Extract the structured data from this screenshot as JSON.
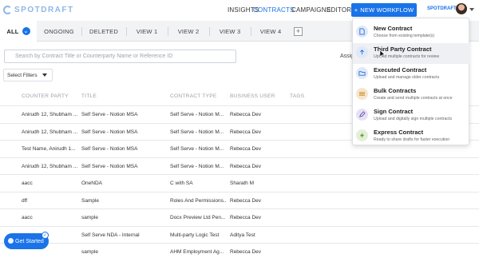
{
  "header": {
    "logo_text": "SPOTDRAFT",
    "nav": [
      "INSIGHTS",
      "CONTRACTS",
      "CAMPAIGNS",
      "EDITOR"
    ],
    "new_workflow": "NEW WORKFLOW",
    "brand_small": "SPOTDRAFT",
    "accent": "#1a73e8"
  },
  "tabs": {
    "items": [
      "ALL",
      "ONGOING",
      "DELETED",
      "VIEW 1",
      "VIEW 2",
      "VIEW 3",
      "VIEW 4"
    ],
    "add": "+"
  },
  "search": {
    "placeholder": "Search by Contract Title or Counterparty Name or Reference ID"
  },
  "assign_label": "Assig",
  "filters_label": "Select Filters",
  "table": {
    "columns": [
      "COUNTER PARTY",
      "TITLE",
      "CONTRACT TYPE",
      "BUSINESS USER",
      "TAGS"
    ],
    "rows": [
      [
        "Anirudh 12, Shubham ...",
        "Self Serve - Notion MSA",
        "Self Serve - Notion M...",
        "Rebecca Dev",
        ""
      ],
      [
        "Anirudh 12, Shubham ...",
        "Self Serve - Notion MSA",
        "Self Serve - Notion M...",
        "Rebecca Dev",
        ""
      ],
      [
        "Test Name, Anirudh 1...",
        "Self Serve - Notion MSA",
        "Self Serve - Notion M...",
        "Rebecca Dev",
        ""
      ],
      [
        "Anirudh 12, Shubham ...",
        "Self Serve - Notion MSA",
        "Self Serve - Notion M...",
        "Rebecca Dev",
        ""
      ],
      [
        "aacc",
        "OneNDA",
        "C with SA",
        "Sharath M",
        ""
      ],
      [
        "dff",
        "Sample",
        "Roles And Permissions...",
        "Rebecca Dev",
        ""
      ],
      [
        "aacc",
        "sample",
        "Docx Preview Ltd Pen...",
        "Rebecca Dev",
        ""
      ],
      [
        "aaa",
        "Self Serve NDA - Internal",
        "Multi-party Logic Test",
        "Aditya Test",
        ""
      ],
      [
        "",
        "sample",
        "AHM Employment Ag...",
        "Rebecca Dev",
        ""
      ]
    ]
  },
  "menu": {
    "items": [
      {
        "title": "New Contract",
        "subtitle": "Choose from existing template(s)",
        "icon": "document-icon",
        "color": "#dfe9f8"
      },
      {
        "title": "Third Party Contract",
        "subtitle": "Upload multiple contracts for review",
        "icon": "upload-icon",
        "color": "#dfe9f8"
      },
      {
        "title": "Executed Contract",
        "subtitle": "Upload and manage older contracts",
        "icon": "folder-icon",
        "color": "#dfe9f8"
      },
      {
        "title": "Bulk Contracts",
        "subtitle": "Create and send multiple contracts at once",
        "icon": "stack-icon",
        "color": "#f6e6cc"
      },
      {
        "title": "Sign Contract",
        "subtitle": "Upload and digitally sign multiple contracts",
        "icon": "pen-icon",
        "color": "#e6e1f4"
      },
      {
        "title": "Express Contract",
        "subtitle": "Ready to share drafts for faster execution",
        "icon": "bolt-icon",
        "color": "#e3efd7"
      }
    ]
  },
  "get_started": "Get Started"
}
